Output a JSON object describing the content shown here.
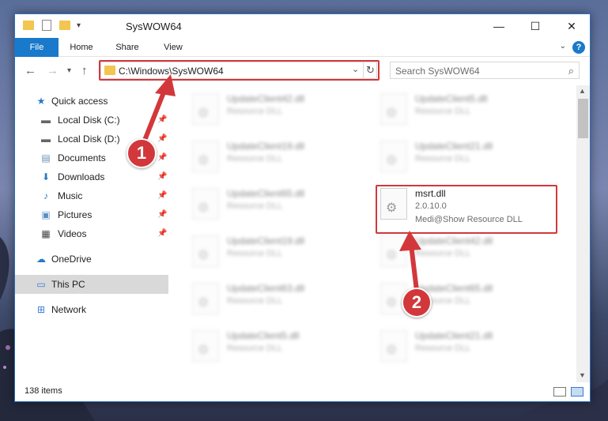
{
  "window": {
    "title": "SysWOW64",
    "controls": {
      "minimize": "—",
      "maximize": "☐",
      "close": "✕"
    }
  },
  "ribbon": {
    "tabs": [
      {
        "label": "File"
      },
      {
        "label": "Home"
      },
      {
        "label": "Share"
      },
      {
        "label": "View"
      }
    ],
    "help": "?"
  },
  "navbar": {
    "address": "C:\\Windows\\SysWOW64",
    "search_placeholder": "Search SysWOW64"
  },
  "sidebar": {
    "items": [
      {
        "label": "Quick access",
        "icon": "star-icon"
      },
      {
        "label": "Local Disk (C:)",
        "icon": "drive-icon"
      },
      {
        "label": "Local Disk (D:)",
        "icon": "drive-icon"
      },
      {
        "label": "Documents",
        "icon": "documents-icon"
      },
      {
        "label": "Downloads",
        "icon": "download-icon"
      },
      {
        "label": "Music",
        "icon": "music-icon"
      },
      {
        "label": "Pictures",
        "icon": "pictures-icon"
      },
      {
        "label": "Videos",
        "icon": "videos-icon"
      },
      {
        "label": "OneDrive",
        "icon": "cloud-icon"
      },
      {
        "label": "This PC",
        "icon": "computer-icon"
      },
      {
        "label": "Network",
        "icon": "network-icon"
      }
    ]
  },
  "files": {
    "left": [
      {
        "name": "UpdateClient42.dll",
        "type": "Resource DLL"
      },
      {
        "name": "UpdateClient19.dll",
        "type": "Resource DLL"
      },
      {
        "name": "UpdateClient65.dll",
        "type": "Resource DLL"
      },
      {
        "name": "UpdateClient19.dll",
        "type": "Resource DLL"
      },
      {
        "name": "UpdateClient63.dll",
        "type": "Resource DLL"
      },
      {
        "name": "UpdateClient5.dll",
        "type": "Resource DLL"
      }
    ],
    "right": [
      {
        "name": "UpdateClient5.dll",
        "type": "Resource DLL"
      },
      {
        "name": "UpdateClient21.dll",
        "type": "Resource DLL"
      },
      {
        "name": "UpdateClient42.dll",
        "type": "Resource DLL"
      },
      {
        "name": "UpdateClient65.dll",
        "type": "Resource DLL"
      },
      {
        "name": "UpdateClient21.dll",
        "type": "Resource DLL"
      }
    ],
    "highlighted": {
      "name": "msrt.dll",
      "version": "2.0.10.0",
      "description": "Medi@Show Resource DLL"
    }
  },
  "status": {
    "item_count": "138 items"
  },
  "markers": {
    "one": "1",
    "two": "2"
  },
  "colors": {
    "accent": "#1979ca",
    "highlight_red": "#d2383b",
    "folder": "#f3c551"
  }
}
